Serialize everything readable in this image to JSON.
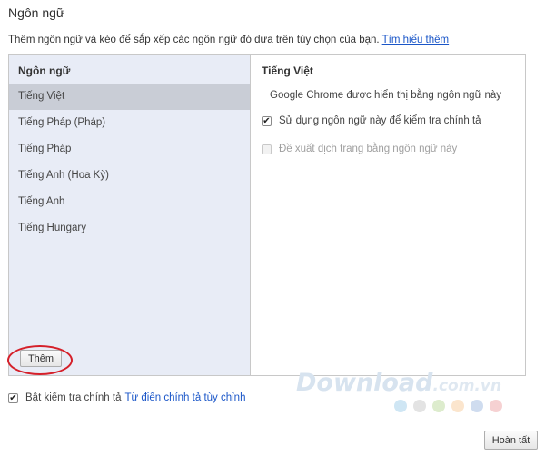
{
  "dialog": {
    "title": "Ngôn ngữ",
    "intro": "Thêm ngôn ngữ và kéo để sắp xếp các ngôn ngữ đó dựa trên tùy chọn của bạn.",
    "learn_more": "Tìm hiểu thêm"
  },
  "languages": {
    "header": "Ngôn ngữ",
    "items": [
      {
        "label": "Tiếng Việt",
        "selected": true
      },
      {
        "label": "Tiếng Pháp (Pháp)",
        "selected": false
      },
      {
        "label": "Tiếng Pháp",
        "selected": false
      },
      {
        "label": "Tiếng Anh (Hoa Kỳ)",
        "selected": false
      },
      {
        "label": "Tiếng Anh",
        "selected": false
      },
      {
        "label": "Tiếng Hungary",
        "selected": false
      }
    ],
    "add_button": "Thêm"
  },
  "details": {
    "title": "Tiếng Việt",
    "description": "Google Chrome được hiển thị bằng ngôn ngữ này",
    "spellcheck_option": {
      "label": "Sử dụng ngôn ngữ này để kiểm tra chính tả",
      "checked": true
    },
    "translate_option": {
      "label": "Đề xuất dịch trang bằng ngôn ngữ này",
      "checked": false,
      "disabled": true
    }
  },
  "footer": {
    "enable_spellcheck": {
      "label": "Bật kiểm tra chính tả",
      "checked": true
    },
    "custom_dictionary": "Từ điển chính tả tùy chỉnh",
    "done_button": "Hoàn tất"
  },
  "watermark": {
    "brand": "Download",
    "domain": ".com.vn",
    "dot_colors": [
      "#cfe6f4",
      "#e3e3e3",
      "#ddeccd",
      "#fbe5cd",
      "#cfdcef",
      "#f6d1d2"
    ]
  },
  "colors": {
    "link": "#1a56c8",
    "highlight_ring": "#d5202a",
    "list_background": "#e8ecf6",
    "selected_row": "#c9cdd6"
  }
}
